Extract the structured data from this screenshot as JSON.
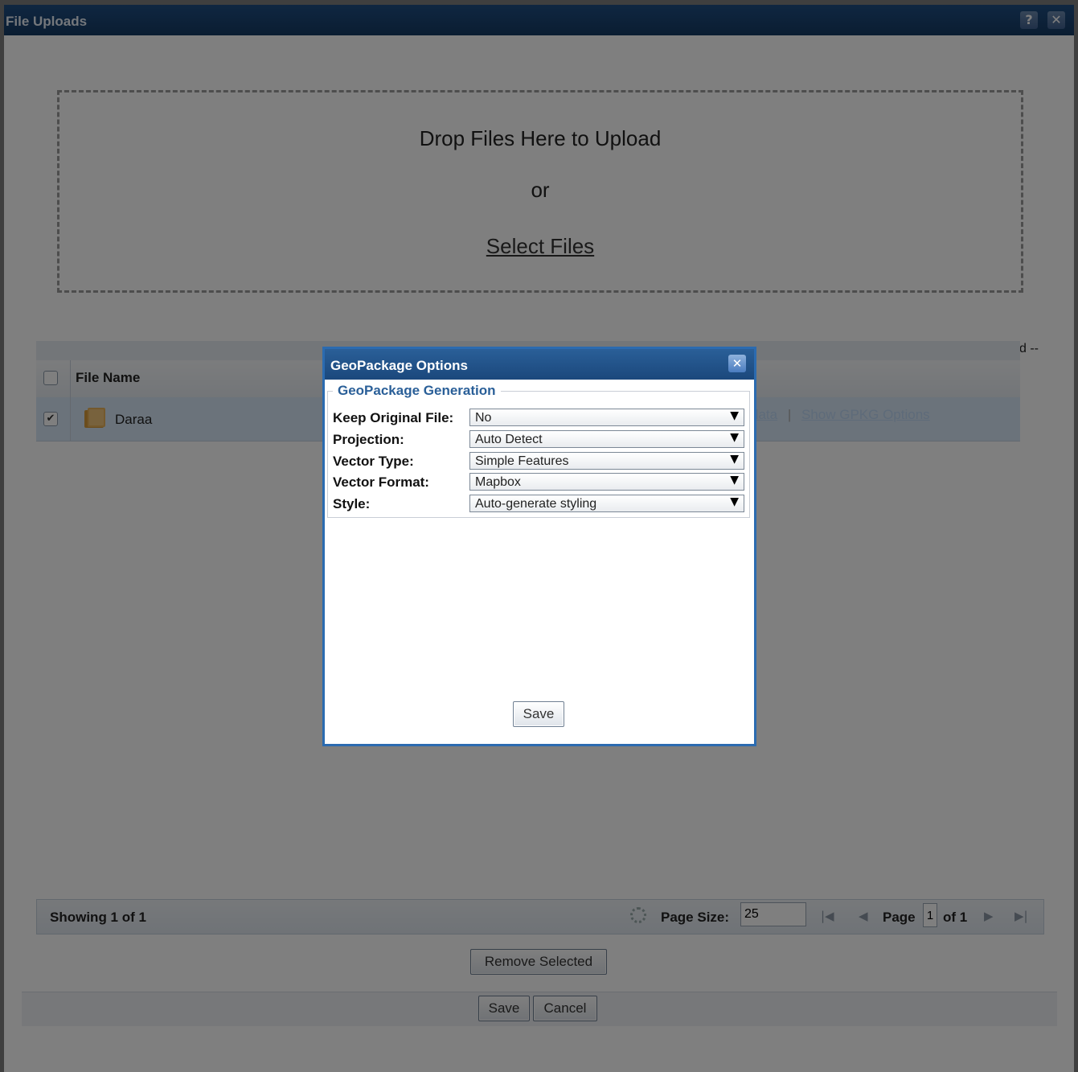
{
  "window": {
    "title": "File Uploads",
    "help_icon": "help-icon",
    "close_icon": "close-icon"
  },
  "dropzone": {
    "title": "Drop Files Here to Upload",
    "or": "or",
    "select_link": "Select Files"
  },
  "grid": {
    "selected_count": "1/1 selected --",
    "header_name": "File Name",
    "rows": [
      {
        "name": "Daraa",
        "checked": true,
        "link_metadata": "data",
        "link_separator": "|",
        "link_options": "Show GPKG Options"
      }
    ]
  },
  "footer": {
    "showing": "Showing 1 of 1",
    "page_size_label": "Page Size:",
    "page_size_value": "25",
    "page_label": "Page",
    "page_value": "1",
    "of_label": "of 1"
  },
  "buttons": {
    "remove_selected": "Remove Selected",
    "save": "Save",
    "cancel": "Cancel"
  },
  "dialog": {
    "title": "GeoPackage Options",
    "legend": "GeoPackage Generation",
    "fields": [
      {
        "label": "Keep Original File:",
        "value": "No"
      },
      {
        "label": "Projection:",
        "value": "Auto Detect"
      },
      {
        "label": "Vector Type:",
        "value": "Simple Features"
      },
      {
        "label": "Vector Format:",
        "value": "Mapbox"
      },
      {
        "label": "Style:",
        "value": "Auto-generate styling"
      }
    ],
    "save": "Save"
  },
  "colors": {
    "titlebar": "#1b487c",
    "dialog_border": "#2b6bb0",
    "selected_row": "#d7e7f7"
  }
}
